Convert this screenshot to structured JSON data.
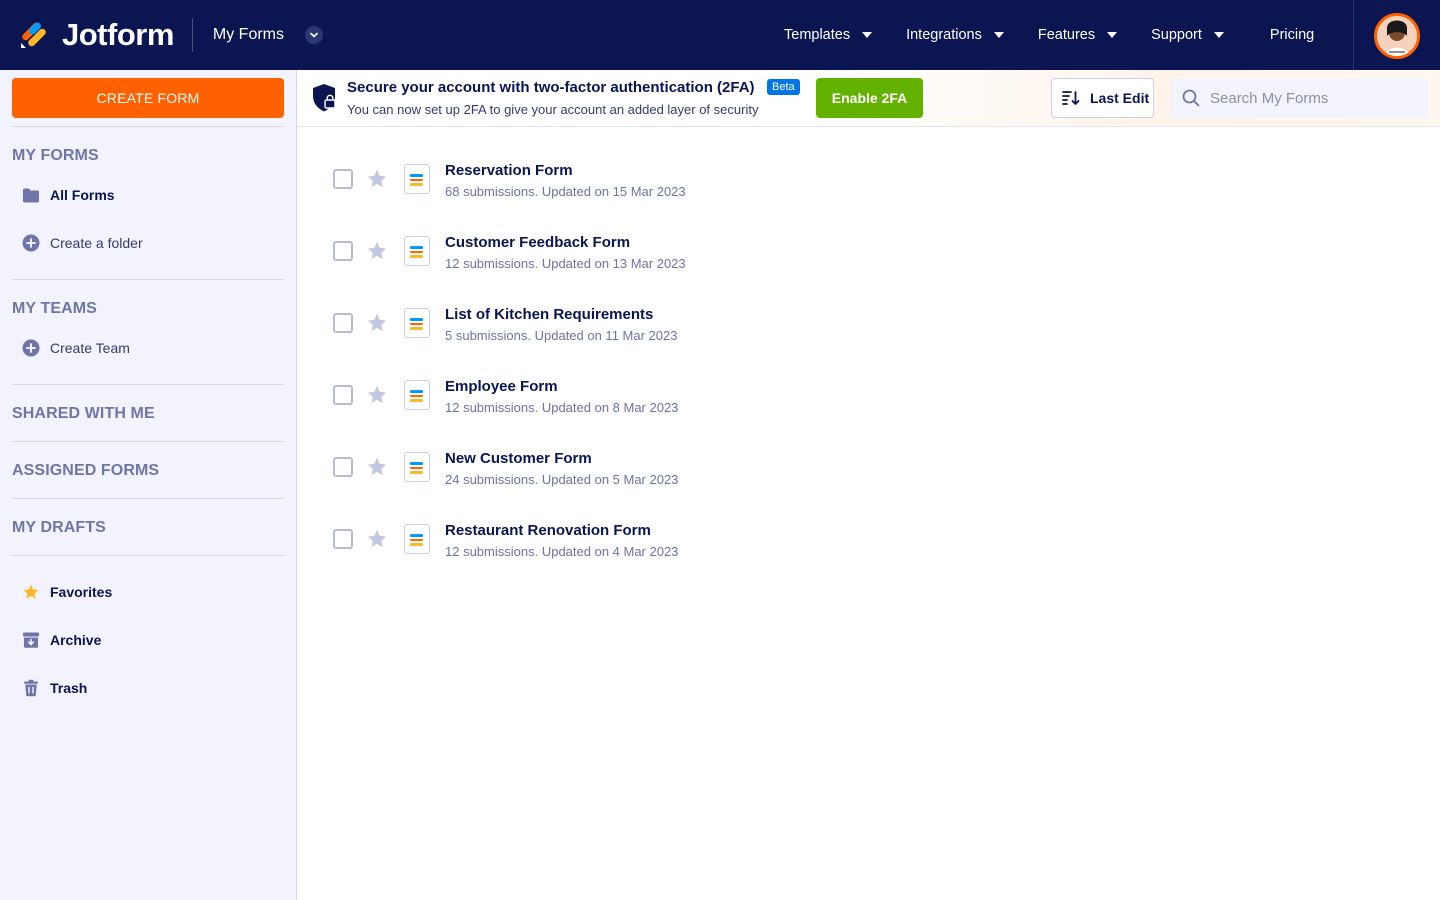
{
  "app": {
    "logo_text": "Jotform",
    "section": "My Forms"
  },
  "nav": {
    "links": [
      {
        "label": "Templates",
        "has_caret": true
      },
      {
        "label": "Integrations",
        "has_caret": true
      },
      {
        "label": "Features",
        "has_caret": true
      },
      {
        "label": "Support",
        "has_caret": true
      },
      {
        "label": "Pricing",
        "has_caret": false
      }
    ]
  },
  "sidebar": {
    "create_label": "CREATE FORM",
    "my_forms": "MY FORMS",
    "all_forms": "All Forms",
    "create_folder": "Create a folder",
    "my_teams": "MY TEAMS",
    "create_team": "Create Team",
    "shared": "SHARED WITH ME",
    "assigned": "ASSIGNED FORMS",
    "drafts": "MY DRAFTS",
    "favorites": "Favorites",
    "archive": "Archive",
    "trash": "Trash"
  },
  "banner": {
    "title": "Secure your account with two-factor authentication (2FA)",
    "badge": "Beta",
    "subtitle": "You can now set up 2FA to give your account an added layer of security",
    "button": "Enable 2FA"
  },
  "toolbar": {
    "sort_label": "Last Edit",
    "search_placeholder": "Search My Forms"
  },
  "forms": [
    {
      "name": "Reservation Form",
      "meta": "68 submissions. Updated on 15 Mar 2023"
    },
    {
      "name": "Customer Feedback Form",
      "meta": "12 submissions. Updated on 13 Mar 2023"
    },
    {
      "name": "List of Kitchen Requirements",
      "meta": "5 submissions. Updated on 11 Mar 2023"
    },
    {
      "name": "Employee Form",
      "meta": "12 submissions. Updated on 8 Mar 2023"
    },
    {
      "name": "New Customer Form",
      "meta": "24 submissions. Updated on 5 Mar 2023"
    },
    {
      "name": "Restaurant Renovation Form",
      "meta": "12 submissions. Updated on 4 Mar 2023"
    }
  ],
  "colors": {
    "nav_bg": "#0a1551",
    "create_button": "#ff6100",
    "enable_button": "#64b200",
    "beta_badge": "#0075e3",
    "star": "#c3c7df",
    "favorite_star": "#ffb629"
  },
  "icons": {
    "logo": "jotform-logo-icon",
    "chevron": "chevron-down-icon",
    "folder": "folder-icon",
    "add": "plus-circle-icon",
    "shield": "shield-lock-icon",
    "sort": "sort-icon",
    "search": "search-icon",
    "star": "star-icon",
    "form": "form-document-icon",
    "archive": "archive-icon",
    "trash": "trash-icon"
  }
}
